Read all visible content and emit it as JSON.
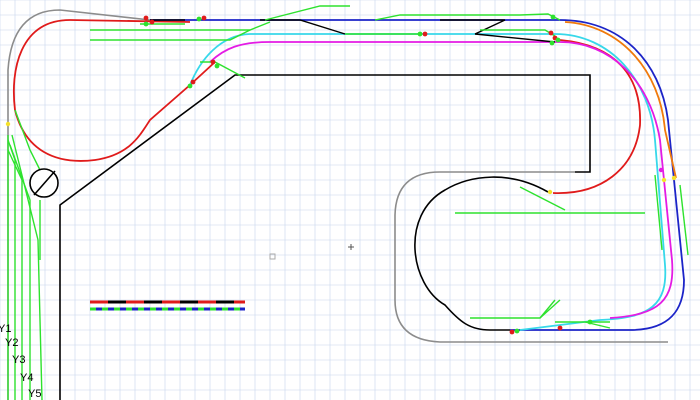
{
  "diagram": {
    "background": "#ffffff",
    "grid_color": "#c7d6ec",
    "colors": {
      "outline": "#000000",
      "gray": "#8c8c8c",
      "red": "#e01b1b",
      "blue": "#1c24c8",
      "cyan": "#37d8ea",
      "magenta": "#e41be4",
      "orange": "#f07a0c",
      "green": "#2ee22e",
      "yellow": "#f5e12a"
    },
    "yard_labels": [
      "Y1",
      "Y2",
      "Y3",
      "Y4",
      "Y5"
    ]
  }
}
